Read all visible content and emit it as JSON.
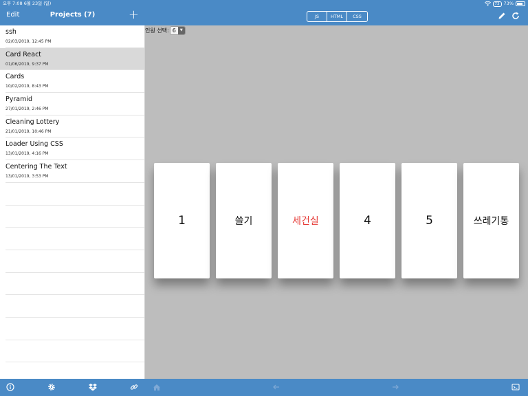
{
  "status_bar": {
    "time_date": "오후 7:08   6월 23일 (일)",
    "battery_badge": "73",
    "battery_percent": "73%"
  },
  "sidebar": {
    "edit_label": "Edit",
    "title": "Projects (7)",
    "add_label": "+",
    "selected_index": 1,
    "projects": [
      {
        "name": "ssh",
        "date": "02/03/2019, 12:45 PM"
      },
      {
        "name": "Card React",
        "date": "01/06/2019, 9:37 PM"
      },
      {
        "name": "Cards",
        "date": "10/02/2019, 8:43 PM"
      },
      {
        "name": "Pyramid",
        "date": "27/01/2019, 2:46 PM"
      },
      {
        "name": "Cleaning Lottery",
        "date": "21/01/2019, 10:46 PM"
      },
      {
        "name": "Loader Using CSS",
        "date": "13/01/2019, 4:16 PM"
      },
      {
        "name": "Centering The Text",
        "date": "13/01/2019, 3:53 PM"
      }
    ]
  },
  "toolbar": {
    "tabs": [
      "JS",
      "HTML",
      "CSS"
    ]
  },
  "preview": {
    "select_label": "인원 선택:",
    "select_value": "6",
    "cards": [
      {
        "text": "1",
        "color": "#111111"
      },
      {
        "text": "쓸기",
        "color": "#111111"
      },
      {
        "text": "세건실",
        "color": "#e53935"
      },
      {
        "text": "4",
        "color": "#111111"
      },
      {
        "text": "5",
        "color": "#111111"
      },
      {
        "text": "쓰레기통",
        "color": "#111111"
      }
    ]
  },
  "colors": {
    "accent": "#4a8ac6",
    "preview_bg": "#bdbdbd",
    "highlight_card": "#e53935"
  },
  "icons": {
    "footer_left": [
      "info-icon",
      "gear-icon",
      "dropbox-icon",
      "link-icon"
    ],
    "footer_right": [
      "home-icon",
      "back-arrow-icon",
      "forward-arrow-icon",
      "console-icon"
    ],
    "header_right": [
      "pencil-icon",
      "refresh-icon"
    ]
  }
}
